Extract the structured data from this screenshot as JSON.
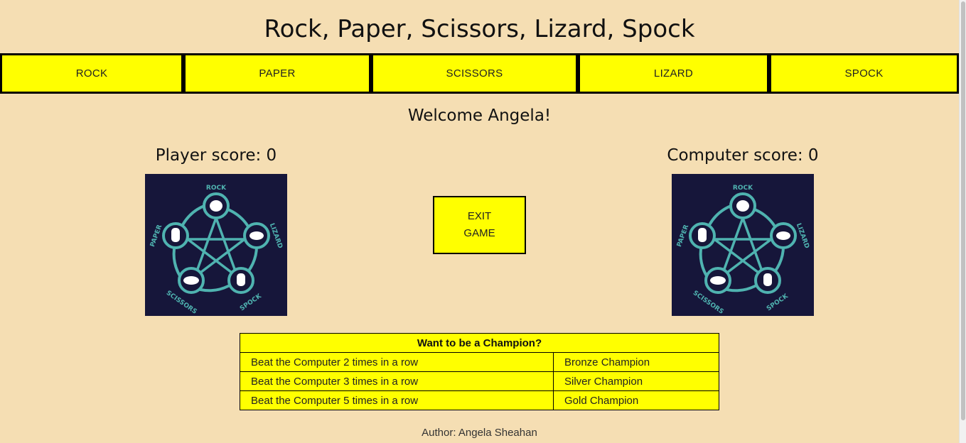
{
  "title": "Rock, Paper, Scissors, Lizard, Spock",
  "choices": [
    {
      "label": "ROCK"
    },
    {
      "label": "PAPER"
    },
    {
      "label": "SCISSORS"
    },
    {
      "label": "LIZARD"
    },
    {
      "label": "SPOCK"
    }
  ],
  "welcome": "Welcome Angela!",
  "scores": {
    "player": "Player score: 0",
    "computer": "Computer score: 0"
  },
  "emblem": {
    "labels": {
      "rock": "ROCK",
      "paper": "PAPER",
      "scissors": "SCISSORS",
      "spock": "SPOCK",
      "lizard": "LIZARD"
    },
    "icon": "rpsls-cycle-icon"
  },
  "exit_button": {
    "line1": "EXIT",
    "line2": "GAME"
  },
  "champion_table": {
    "header": "Want to be a Champion?",
    "rows": [
      {
        "goal": "Beat the Computer 2 times in a row",
        "rank": "Bronze Champion"
      },
      {
        "goal": "Beat the Computer 3 times in a row",
        "rank": "Silver Champion"
      },
      {
        "goal": "Beat the Computer 5 times in a row",
        "rank": "Gold Champion"
      }
    ]
  },
  "author": "Author: Angela Sheahan",
  "colors": {
    "background": "#f5deb3",
    "button": "#ffff00",
    "emblem_bg": "#16163a",
    "emblem_accent": "#4fb3b0"
  }
}
